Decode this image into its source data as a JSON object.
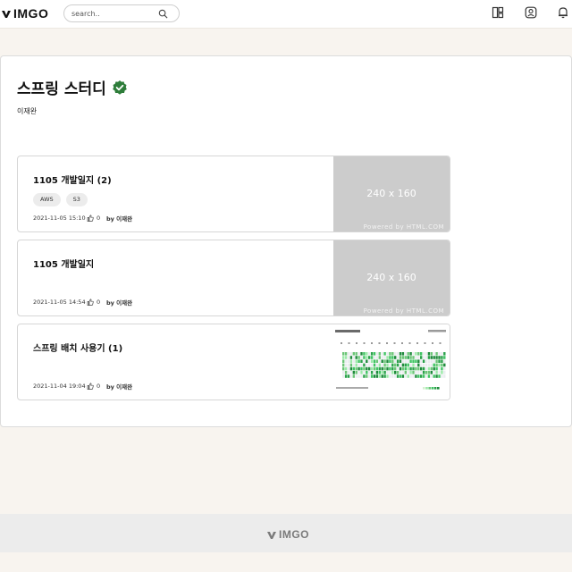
{
  "header": {
    "logo_text": "IMGO",
    "search_placeholder": "search..",
    "icons": [
      "layout-icon",
      "user-icon",
      "bell-icon"
    ]
  },
  "study": {
    "title": "스프링 스터디",
    "author": "이재완",
    "verified_color": "#2e7d3a"
  },
  "posts": [
    {
      "title": "1105 개발일지 (2)",
      "tags": [
        "AWS",
        "S3"
      ],
      "date": "2021-11-05 15:10",
      "likes": "0",
      "by": "by 이재완",
      "thumb_text": "240 x 160",
      "thumb_credit": "Powered by HTML.COM"
    },
    {
      "title": "1105 개발일지",
      "tags": [],
      "date": "2021-11-05 14:54",
      "likes": "0",
      "by": "by 이재완",
      "thumb_text": "240 x 160",
      "thumb_credit": "Powered by HTML.COM"
    },
    {
      "title": "스프링 배치 사용기 (1)",
      "tags": [],
      "date": "2021-11-04 19:04",
      "likes": "0",
      "by": "by 이재완",
      "thumb_type": "contribution-graph"
    }
  ],
  "footer": {
    "logo_text": "IMGO"
  }
}
